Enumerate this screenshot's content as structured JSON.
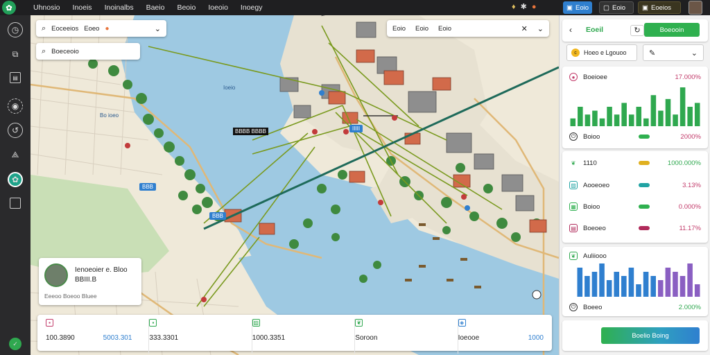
{
  "topbar": {
    "logo_glyph": "✿",
    "nav": [
      "Uhnosio",
      "Inoeis",
      "Inoinalbs",
      "Baeio",
      "Beoio",
      "Ioeoio",
      "Inoegy"
    ],
    "btn_primary": "Eoio",
    "btn_secondary": "Eoio",
    "btn_tertiary": "Eoeios",
    "icons": [
      "bell-icon",
      "gear-icon",
      "user-circle-icon"
    ]
  },
  "map_search": {
    "text": "Eoceeios",
    "badge_text": "Eoeo",
    "tag1": "Eoio",
    "tag2": "Eoio",
    "tag3": "Eoio",
    "place_query": "Boeceoio"
  },
  "map_labels": {
    "bay": "Ioeio",
    "district": "Bo ioeo",
    "label_black_1": "BBBB BBBB",
    "label_blue_1": "IIIII",
    "label_blue_2": "BBB",
    "label_blue_3": "BBB"
  },
  "profile_card": {
    "name": "Ienoeoier e. Bloo",
    "code": "BBIII.B",
    "meta": "Eeeoo Boeoo Bluee"
  },
  "bottom_stats": [
    {
      "icon": "box-icon",
      "value": "100.3890",
      "secondary": "5003.301",
      "color": "#c23b6a",
      "value_color": "#222"
    },
    {
      "icon": "box-icon",
      "value": "333.3301",
      "secondary": "",
      "color": "#2fa84f",
      "value_color": "#222"
    },
    {
      "icon": "chart-icon",
      "value": "1000.3351",
      "secondary": "",
      "color": "#2fa84f",
      "value_color": "#222"
    },
    {
      "icon": "sprout-icon",
      "value": "Soroon",
      "secondary": "",
      "color": "#2fa84f",
      "value_color": "#222"
    },
    {
      "icon": "cube-icon",
      "value": "Ioeooe",
      "secondary": "1000",
      "color": "#2f7fcf",
      "value_color": "#222"
    }
  ],
  "right_panel": {
    "header_title": "Eoeil",
    "header_btn": "Boeooin",
    "dropdown_value": "Hoeo e Lgouoo",
    "section1_label": "Boeioee",
    "section1_value": "17.000%",
    "section1_footer_label": "Boioo",
    "section1_footer_value": "2000%",
    "section2_label": "1110",
    "section2_value": "1000.000%",
    "metrics": [
      {
        "icon": "chart-icon",
        "label": "Aooeoeo",
        "bar_color": "#21a3a3",
        "value": "3.13%",
        "color": "#2f7fcf"
      },
      {
        "icon": "grid-icon",
        "label": "Boioo",
        "bar_color": "#2fb04f",
        "value": "0.000%",
        "color": "#2fa84f"
      },
      {
        "icon": "table-icon",
        "label": "Boeoeo",
        "bar_color": "#b02a5a",
        "value": "11.17%",
        "color": "#2fa84f"
      }
    ],
    "section3_label": "Auliiooo",
    "section3_footer_label": "Boeeo",
    "section3_footer_value": "2.000%",
    "action_button": "Boelio Boing",
    "colors": {
      "green": "#2fa84f",
      "blue": "#2f7fcf",
      "purple": "#8a5fc2",
      "red": "#c23b6a"
    }
  },
  "chart_data": [
    {
      "type": "bar",
      "title": "",
      "values": [
        2,
        5,
        3,
        4,
        2,
        5,
        3,
        6,
        3,
        5,
        2,
        8,
        4,
        7,
        3,
        10,
        5,
        6
      ],
      "color": "#2fa84f"
    },
    {
      "type": "bar",
      "title": "",
      "series": [
        {
          "values": [
            7,
            5,
            6,
            8,
            4,
            6,
            5,
            7,
            3,
            6,
            5,
            4,
            7,
            6,
            5,
            8,
            3
          ]
        }
      ]
    }
  ]
}
